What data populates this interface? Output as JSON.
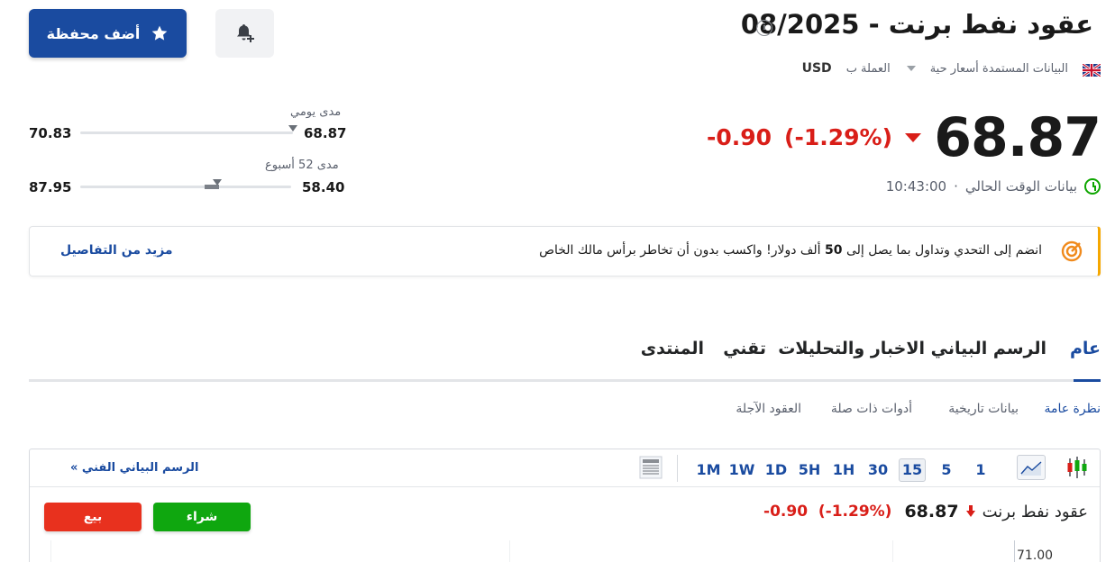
{
  "header": {
    "title": "عقود نفط برنت - 08/2025",
    "data_type_label": "البيانات المستمدة أسعار حية",
    "currency_label": "العملة ب",
    "currency_value": "USD",
    "watchlist_button": "أضف محفظة"
  },
  "quote": {
    "price": "68.87",
    "change": "-0.90",
    "change_pct": "(-1.29%)",
    "time_label": "بيانات الوقت الحالي",
    "time_value": "10:43:00"
  },
  "ranges": {
    "daily": {
      "label": "مدى يومي",
      "low": "68.87",
      "high": "70.83",
      "position": 0
    },
    "week52": {
      "label": "مدى 52 أسبوع",
      "low": "58.40",
      "high": "87.95",
      "position": 0.35
    }
  },
  "banner": {
    "text_before": "انضم إلى التحدي وتداول بما يصل إلى ",
    "text_bold": "50",
    "text_after": " ألف دولار! واكسب بدون أن تخاطر برأس مالك الخاص",
    "link": "مزيد من التفاصيل"
  },
  "tabs": [
    {
      "label": "عام",
      "active": true
    },
    {
      "label": "الرسم البياني",
      "active": false
    },
    {
      "label": "الاخبار والتحليلات",
      "active": false
    },
    {
      "label": "تقني",
      "active": false
    },
    {
      "label": "المنتدى",
      "active": false
    }
  ],
  "subtabs": [
    {
      "label": "نظرة عامة",
      "active": true
    },
    {
      "label": "بيانات تاريخية",
      "active": false
    },
    {
      "label": "أدوات ذات صلة",
      "active": false
    },
    {
      "label": "العقود الآجلة",
      "active": false
    }
  ],
  "chart_toolbar": {
    "intervals": [
      "1",
      "5",
      "15",
      "30",
      "1H",
      "5H",
      "1D",
      "1W",
      "1M"
    ],
    "selected": "15",
    "tech_chart_link": "الرسم البياني الفني »"
  },
  "mini_quote": {
    "name": "عقود نفط برنت",
    "price": "68.87",
    "change": "-0.90",
    "change_pct": "(-1.29%)",
    "buy_label": "شراء",
    "sell_label": "بيع",
    "y_axis_top": "71.00"
  },
  "colors": {
    "brand": "#1a4ba0",
    "negative": "#d91e18",
    "buy": "#0fa70f",
    "sell": "#e8311e",
    "banner_accent": "#f5a700"
  }
}
